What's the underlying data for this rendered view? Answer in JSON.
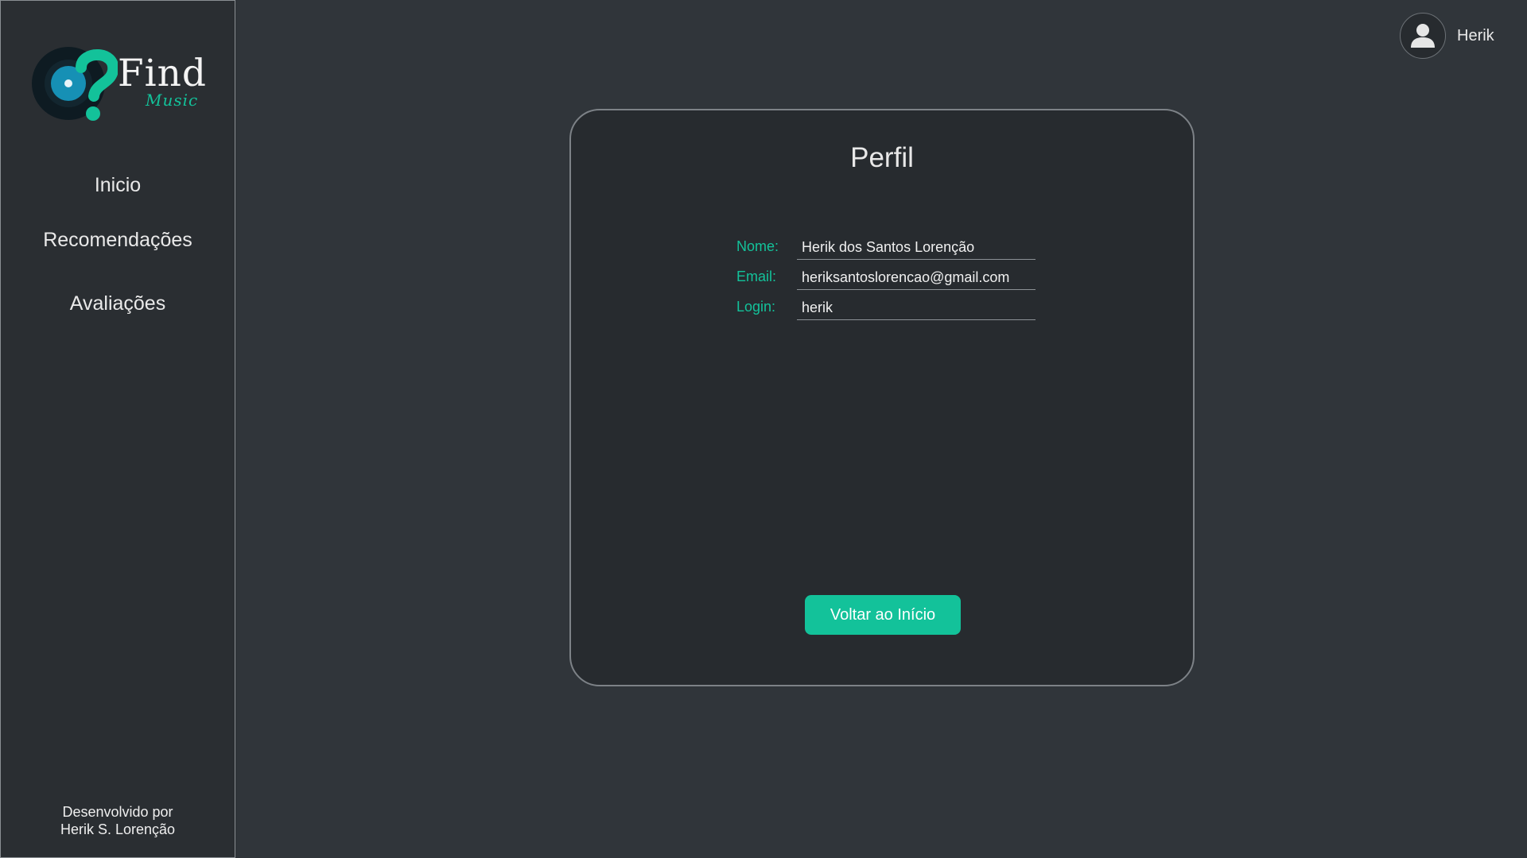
{
  "brand": {
    "name": "Find",
    "sub": "Music",
    "colors": {
      "accent": "#13c29a",
      "logo_disc": "#0e1b22",
      "logo_label": "#1690b5"
    }
  },
  "sidebar": {
    "items": [
      {
        "label": "Inicio",
        "icon": ""
      },
      {
        "label": "Recomendações",
        "icon": ""
      },
      {
        "label": "Avaliações",
        "icon": ""
      }
    ],
    "credit_line1": "Desenvolvido por",
    "credit_line2": "Herik S. Lorenção"
  },
  "header": {
    "user_icon": "user-avatar-icon",
    "user_name": "Herik"
  },
  "profile": {
    "title": "Perfil",
    "fields": [
      {
        "label": "Nome:",
        "value": "Herik dos Santos Lorenção"
      },
      {
        "label": "Email:",
        "value": "heriksantoslorencao@gmail.com"
      },
      {
        "label": "Login:",
        "value": "herik"
      }
    ],
    "back_button": "Voltar ao Início"
  }
}
